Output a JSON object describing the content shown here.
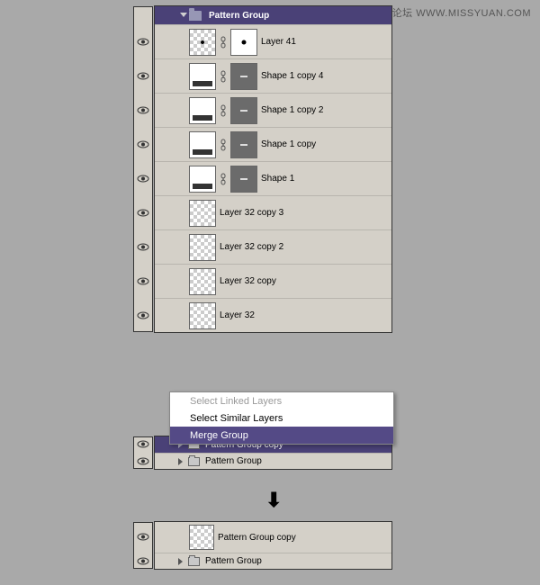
{
  "watermark": "思缘设计论坛  WWW.MISSYUAN.COM",
  "panels": {
    "top": {
      "group_name": "Pattern Group",
      "layers": [
        {
          "name": "Layer 41",
          "kind": "dot"
        },
        {
          "name": "Shape 1 copy 4",
          "kind": "shape"
        },
        {
          "name": "Shape 1 copy 2",
          "kind": "shape"
        },
        {
          "name": "Shape 1 copy",
          "kind": "shape"
        },
        {
          "name": "Shape 1",
          "kind": "shape"
        },
        {
          "name": "Layer 32 copy 3",
          "kind": "checker"
        },
        {
          "name": "Layer 32 copy 2",
          "kind": "checker"
        },
        {
          "name": "Layer 32 copy",
          "kind": "checker"
        },
        {
          "name": "Layer 32",
          "kind": "checker"
        }
      ]
    },
    "mid": {
      "rows": [
        {
          "name": "Pattern Group copy",
          "selected": true,
          "kind": "folder-sel"
        },
        {
          "name": "Pattern Group",
          "selected": false,
          "kind": "folder"
        }
      ]
    },
    "bot": {
      "rows": [
        {
          "name": "Pattern Group copy",
          "kind": "thumb"
        },
        {
          "name": "Pattern Group",
          "kind": "folder"
        }
      ]
    }
  },
  "menu": {
    "items": [
      {
        "label": "Select Linked Layers",
        "disabled": true
      },
      {
        "label": "Select Similar Layers",
        "disabled": false
      },
      {
        "label": "Merge Group",
        "selected": true
      }
    ]
  }
}
